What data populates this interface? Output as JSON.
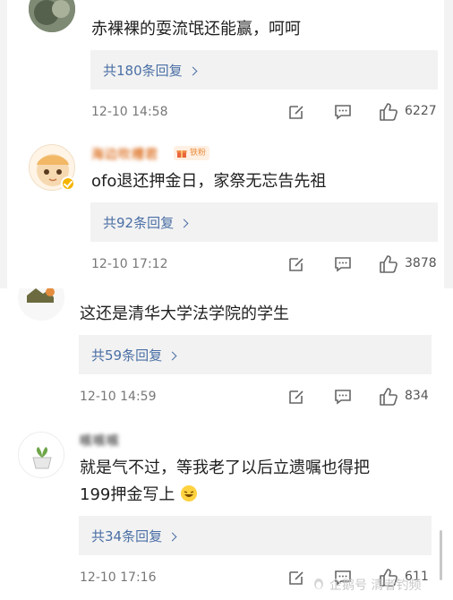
{
  "comments": [
    {
      "username": "",
      "text": "赤裸裸的耍流氓还能赢，呵呵",
      "reply_label": "共180条回复",
      "time": "12-10 14:58",
      "likes": "6227"
    },
    {
      "username": "海边吹槽君",
      "badge": "铁粉",
      "text": "ofo退还押金日，家祭无忘告先祖",
      "reply_label": "共92条回复",
      "time": "12-10 17:12",
      "likes": "3878"
    },
    {
      "username": "",
      "text": "这还是清华大学法学院的学生",
      "reply_label": "共59条回复",
      "time": "12-10 14:59",
      "likes": "834"
    },
    {
      "username": "咳咳咳",
      "text_line1": "就是气不过，等我老了以后立遗嘱也得把",
      "text_line2": "199押金写上",
      "reply_label": "共34条回复",
      "time": "12-10 17:16",
      "likes": "611"
    }
  ],
  "watermark": "企鹅号 清者钓频",
  "colors": {
    "link": "#4a6fa5",
    "reply_bg": "#f2f2f2",
    "username": "#e0803a",
    "badge": "#e78c3c"
  }
}
